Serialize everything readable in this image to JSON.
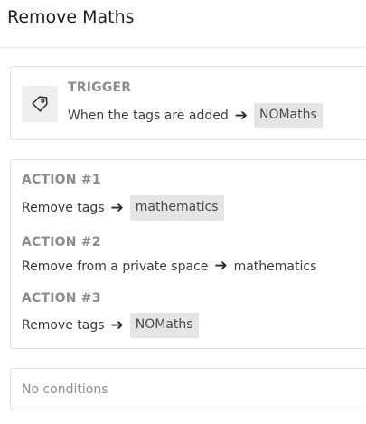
{
  "page": {
    "title": "Remove Maths"
  },
  "trigger": {
    "label": "TRIGGER",
    "icon": "tag-icon",
    "text": "When the tags are added",
    "arrow": "➔",
    "value": "NOMaths"
  },
  "actions": [
    {
      "label": "ACTION #1",
      "text": "Remove tags",
      "arrow": "➔",
      "value": "mathematics",
      "value_is_chip": true
    },
    {
      "label": "ACTION #2",
      "text": "Remove from a private space",
      "arrow": "➔",
      "value": "mathematics",
      "value_is_chip": false
    },
    {
      "label": "ACTION #3",
      "text": "Remove tags",
      "arrow": "➔",
      "value": "NOMaths",
      "value_is_chip": true
    }
  ],
  "conditions": {
    "text": "No conditions"
  },
  "colors": {
    "chip_background": "#e5e5e5",
    "label_gray": "#8c8c8c",
    "border": "#e1e1e1"
  }
}
